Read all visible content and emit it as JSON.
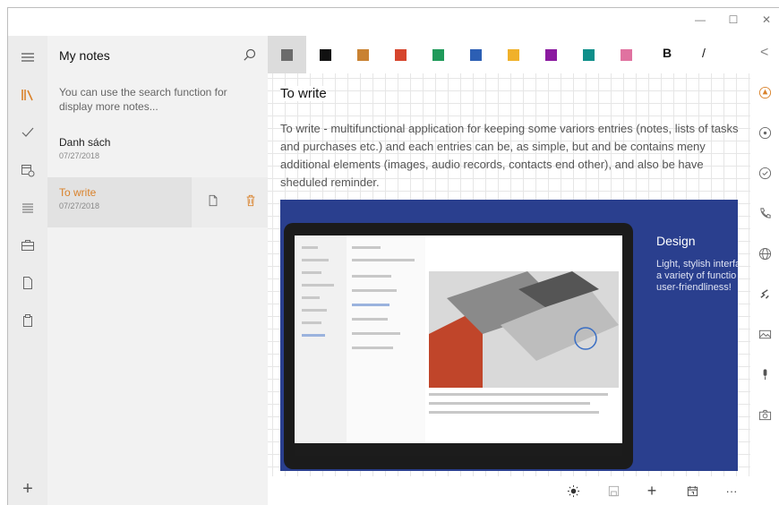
{
  "window": {
    "minimize": "—",
    "maximize": "☐",
    "close": "✕"
  },
  "sidebar": {
    "title": "My notes",
    "hint": "You can use the search function for display more notes...",
    "notes": [
      {
        "title": "Danh sách",
        "date": "07/27/2018"
      },
      {
        "title": "To write",
        "date": "07/27/2018"
      }
    ]
  },
  "toolbar": {
    "colors": [
      "#6b6b6b",
      "#111111",
      "#c98232",
      "#d6452d",
      "#1f9a5a",
      "#2c5fb4",
      "#f0b12a",
      "#8b1aa0",
      "#0f8f8a",
      "#e072a0"
    ],
    "bold": "B",
    "italic": "/",
    "back": "<"
  },
  "note": {
    "title": "To write",
    "body": "To write - multifunctional application for keeping some variors entries (notes, lists of tasks and purchases etc.) and each entries can be, as simple, but and be contains meny additional elements (images, audio records, contacts end other), and also be have sheduled reminder.",
    "promo": {
      "heading": "Design",
      "text": "Light, stylish interfa\na variety of functio\nuser-friendliness!"
    }
  },
  "bottom": {
    "plus": "+",
    "more": "···"
  },
  "rail": {
    "add": "+"
  }
}
